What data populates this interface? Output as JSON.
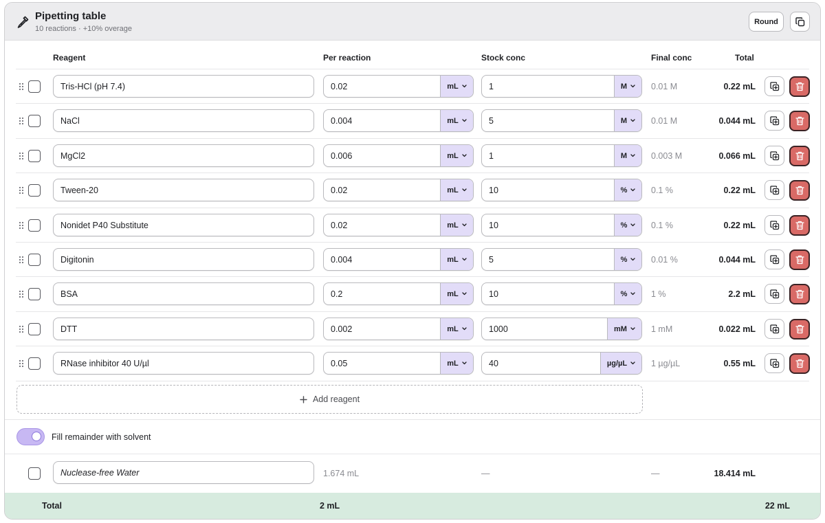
{
  "header": {
    "title": "Pipetting table",
    "subtitle": "10 reactions · +10% overage",
    "round_label": "Round"
  },
  "columns": {
    "reagent": "Reagent",
    "per_reaction": "Per reaction",
    "stock_conc": "Stock conc",
    "final_conc": "Final conc",
    "total": "Total"
  },
  "rows": [
    {
      "name": "Tris-HCl (pH 7.4)",
      "per_value": "0.02",
      "per_unit": "mL",
      "stock_value": "1",
      "stock_unit": "M",
      "final": "0.01 M",
      "total": "0.22 mL"
    },
    {
      "name": "NaCl",
      "per_value": "0.004",
      "per_unit": "mL",
      "stock_value": "5",
      "stock_unit": "M",
      "final": "0.01 M",
      "total": "0.044 mL"
    },
    {
      "name": "MgCl2",
      "per_value": "0.006",
      "per_unit": "mL",
      "stock_value": "1",
      "stock_unit": "M",
      "final": "0.003 M",
      "total": "0.066 mL"
    },
    {
      "name": "Tween-20",
      "per_value": "0.02",
      "per_unit": "mL",
      "stock_value": "10",
      "stock_unit": "%",
      "final": "0.1 %",
      "total": "0.22 mL"
    },
    {
      "name": "Nonidet P40 Substitute",
      "per_value": "0.02",
      "per_unit": "mL",
      "stock_value": "10",
      "stock_unit": "%",
      "final": "0.1 %",
      "total": "0.22 mL"
    },
    {
      "name": "Digitonin",
      "per_value": "0.004",
      "per_unit": "mL",
      "stock_value": "5",
      "stock_unit": "%",
      "final": "0.01 %",
      "total": "0.044 mL"
    },
    {
      "name": "BSA",
      "per_value": "0.2",
      "per_unit": "mL",
      "stock_value": "10",
      "stock_unit": "%",
      "final": "1 %",
      "total": "2.2 mL"
    },
    {
      "name": "DTT",
      "per_value": "0.002",
      "per_unit": "mL",
      "stock_value": "1000",
      "stock_unit": "mM",
      "final": "1 mM",
      "total": "0.022 mL"
    },
    {
      "name": "RNase inhibitor 40 U/µl",
      "per_value": "0.05",
      "per_unit": "mL",
      "stock_value": "40",
      "stock_unit": "µg/µL",
      "final": "1 µg/µL",
      "total": "0.55 mL"
    }
  ],
  "add_reagent": {
    "label": "Add reagent"
  },
  "solvent": {
    "toggle_label": "Fill remainder with solvent",
    "toggle_on": true,
    "name": "Nuclease-free Water",
    "per_reaction": "1.674 mL",
    "stock": "—",
    "final": "—",
    "total": "18.414 mL"
  },
  "totals": {
    "label": "Total",
    "per_reaction": "2 mL",
    "total": "22 mL"
  },
  "colors": {
    "unit_bg": "#e2dcf8",
    "delete_bg": "#d96a66",
    "total_bar_bg": "#d7ebdf",
    "toggle_bg": "#c7b8f3"
  }
}
